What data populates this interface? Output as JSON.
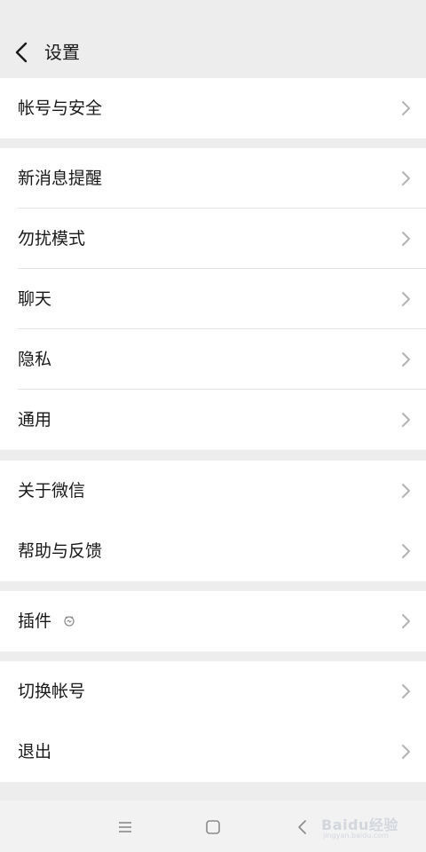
{
  "header": {
    "title": "设置"
  },
  "groups": [
    {
      "items": [
        {
          "label": "帐号与安全"
        }
      ]
    },
    {
      "items": [
        {
          "label": "新消息提醒"
        },
        {
          "label": "勿扰模式"
        },
        {
          "label": "聊天"
        },
        {
          "label": "隐私"
        },
        {
          "label": "通用"
        }
      ]
    },
    {
      "items": [
        {
          "label": "关于微信"
        },
        {
          "label": "帮助与反馈"
        }
      ]
    },
    {
      "items": [
        {
          "label": "插件"
        }
      ]
    },
    {
      "items": [
        {
          "label": "切换帐号"
        },
        {
          "label": "退出"
        }
      ]
    }
  ],
  "watermark": {
    "brand": "Baidu经验",
    "url": "jingyan.baidu.com"
  },
  "icons": {
    "back": "back-arrow-icon",
    "chevron": "chevron-right-icon",
    "plugin_badge": "plugin-badge-icon",
    "nav_menu": "menu-icon",
    "nav_home": "home-square-icon",
    "nav_back": "nav-back-icon"
  },
  "colors": {
    "background": "#ededed",
    "card": "#ffffff",
    "text": "#191919",
    "chevron": "#b2b2b2",
    "divider": "#e5e5e5"
  }
}
